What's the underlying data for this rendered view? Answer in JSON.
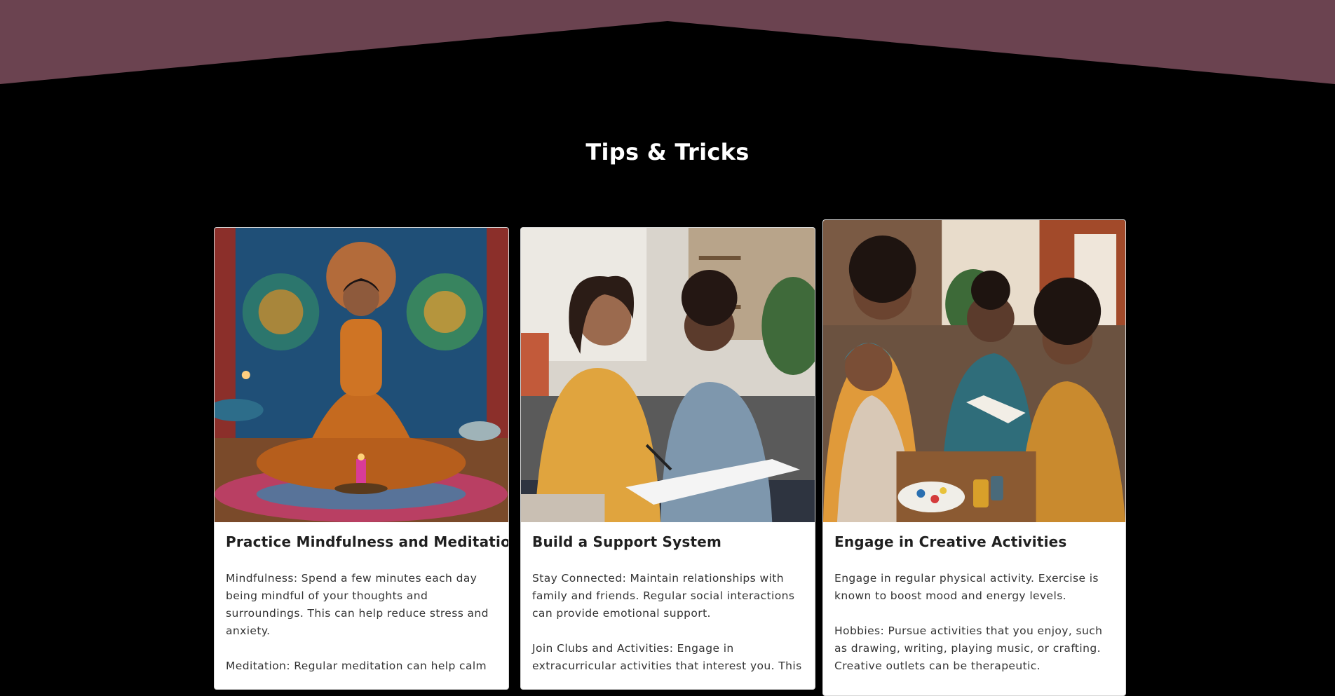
{
  "theme": {
    "top_band_color": "#6b4350",
    "page_background": "#000000",
    "card_background": "#ffffff"
  },
  "section": {
    "title": "Tips & Tricks"
  },
  "cards": [
    {
      "image_description": "woman-meditating-icon",
      "title": "Practice Mindfulness and Meditation",
      "paragraphs": [
        "Mindfulness: Spend a few minutes each day being mindful of your thoughts and surroundings. This can help reduce stress and anxiety.",
        "Meditation: Regular meditation can help calm"
      ]
    },
    {
      "image_description": "friends-talking-icon",
      "title": "Build a Support System",
      "paragraphs": [
        "Stay Connected: Maintain relationships with family and friends. Regular social interactions can provide emotional support.",
        "Join Clubs and Activities: Engage in extracurricular activities that interest you. This"
      ]
    },
    {
      "image_description": "group-painting-icon",
      "title": "Engage in Creative Activities",
      "paragraphs": [
        "Engage in regular physical activity. Exercise is known to boost mood and energy levels.",
        "Hobbies: Pursue activities that you enjoy, such as drawing, writing, playing music, or crafting. Creative outlets can be therapeutic."
      ]
    }
  ]
}
